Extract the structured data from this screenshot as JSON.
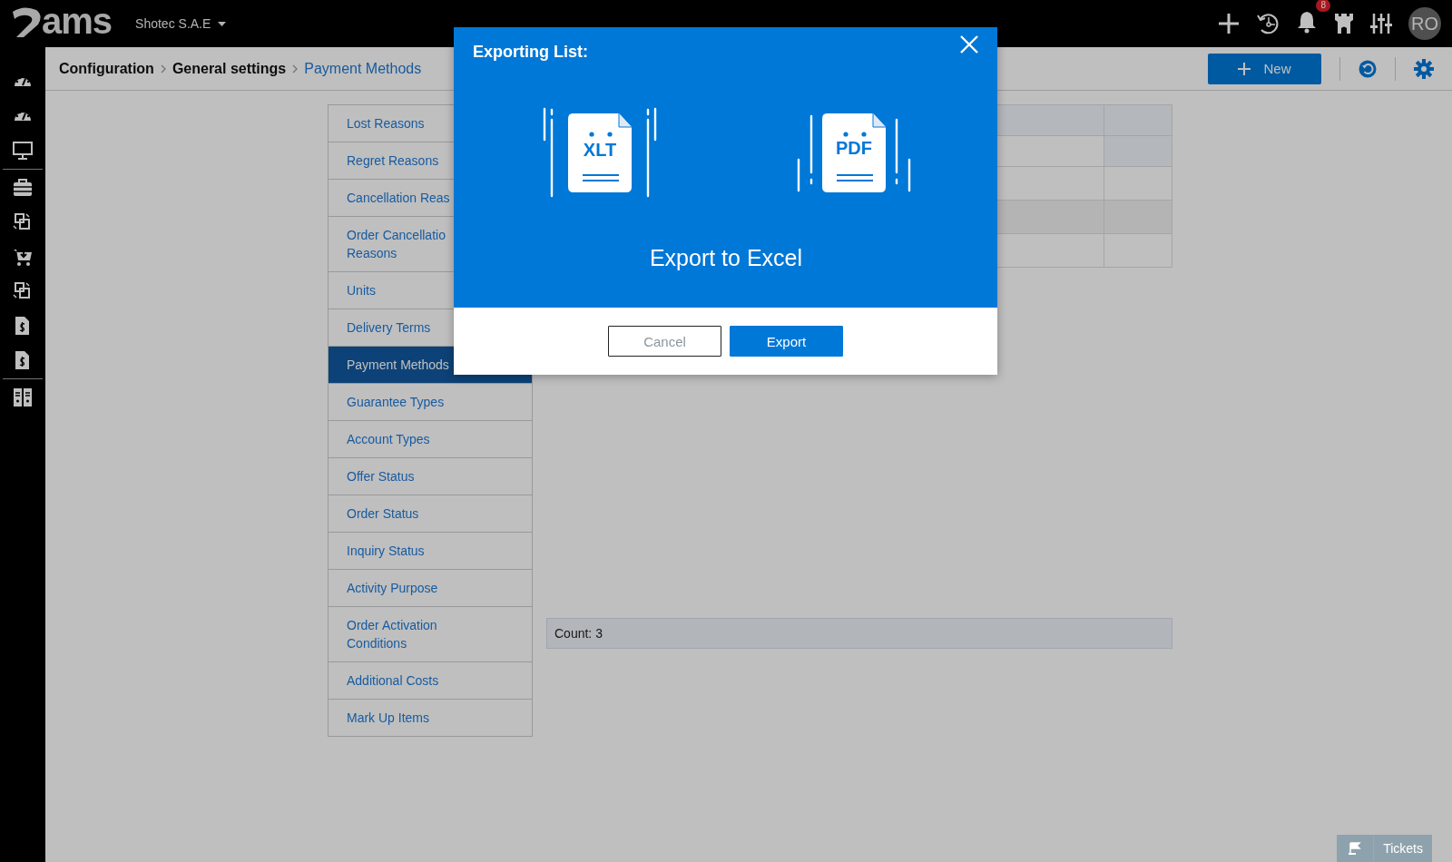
{
  "top_bar": {
    "logo": "ams",
    "company": "Shotec S.A.E",
    "notification_count": "8",
    "avatar": "RO"
  },
  "breadcrumb": [
    {
      "label": "Configuration",
      "current": false
    },
    {
      "label": "General settings",
      "current": false
    },
    {
      "label": "Payment Methods",
      "current": true
    }
  ],
  "toolbar": {
    "new_button": "New"
  },
  "settings_menu": [
    {
      "label": "Lost Reasons",
      "selected": false
    },
    {
      "label": "Regret Reasons",
      "selected": false
    },
    {
      "label": "Cancellation Reas",
      "selected": false
    },
    {
      "label": "Order Cancellatio Reasons",
      "selected": false
    },
    {
      "label": "Units",
      "selected": false
    },
    {
      "label": "Delivery Terms",
      "selected": false
    },
    {
      "label": "Payment Methods",
      "selected": true
    },
    {
      "label": "Guarantee Types",
      "selected": false
    },
    {
      "label": "Account Types",
      "selected": false
    },
    {
      "label": "Offer Status",
      "selected": false
    },
    {
      "label": "Order Status",
      "selected": false
    },
    {
      "label": "Inquiry Status",
      "selected": false
    },
    {
      "label": "Activity Purpose",
      "selected": false
    },
    {
      "label": "Order Activation Conditions",
      "selected": false
    },
    {
      "label": "Additional Costs",
      "selected": false
    },
    {
      "label": "Mark Up Items",
      "selected": false
    }
  ],
  "count": "Count: 3",
  "dialog": {
    "title": "Exporting List:",
    "formats": [
      {
        "label": "XLT"
      },
      {
        "label": "PDF"
      }
    ],
    "heading": "Export to Excel",
    "buttons": [
      {
        "label": "Cancel",
        "kind": "secondary"
      },
      {
        "label": "Export",
        "kind": "primary"
      }
    ]
  },
  "tickets_button": "Tickets"
}
